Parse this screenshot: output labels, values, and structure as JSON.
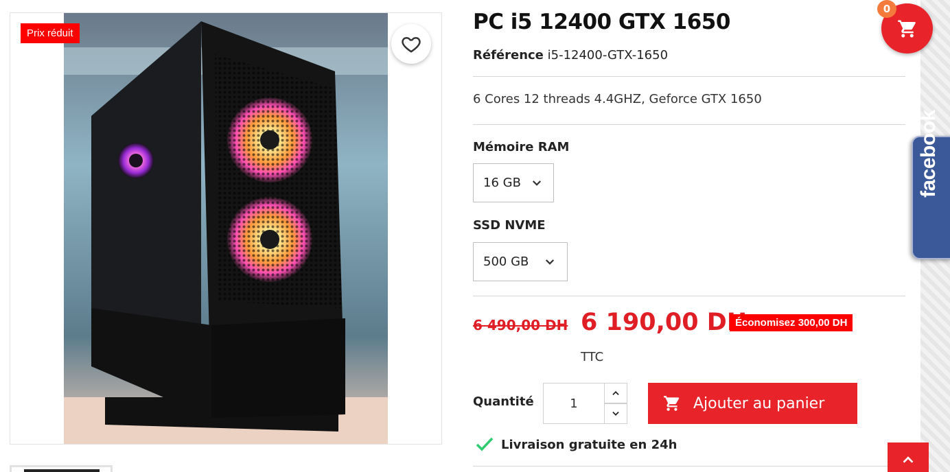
{
  "product": {
    "badge": "Prix réduit",
    "title": "PC i5 12400 GTX 1650",
    "reference_label": "Référence",
    "reference_value": "i5-12400-GTX-1650",
    "description": "6 Cores 12 threads 4.4GHZ, Geforce GTX 1650"
  },
  "variants": {
    "ram_label": "Mémoire RAM",
    "ram_value": "16 GB",
    "ssd_label": "SSD NVME",
    "ssd_value": "500 GB"
  },
  "pricing": {
    "old_price": "6 490,00 DH",
    "price": "6 190,00 DH",
    "discount": "Économisez 300,00 DH",
    "tax_label": "TTC"
  },
  "purchase": {
    "quantity_label": "Quantité",
    "quantity_value": "1",
    "add_to_cart_label": "Ajouter au panier",
    "shipping_text": "Livraison gratuite en 24h"
  },
  "cart": {
    "count": "0"
  },
  "social": {
    "facebook_label": "facebook"
  },
  "colors": {
    "accent_red": "#e8232a",
    "badge_red": "#ff0000",
    "facebook_blue": "#3b5998",
    "check_green": "#2ecc71",
    "cart_badge_orange": "#f47b3b"
  },
  "icons": {
    "wishlist": "heart-icon",
    "cart": "cart-icon",
    "chevron": "chevron-down-icon",
    "check": "check-icon",
    "scroll_top": "chevron-up-icon"
  }
}
